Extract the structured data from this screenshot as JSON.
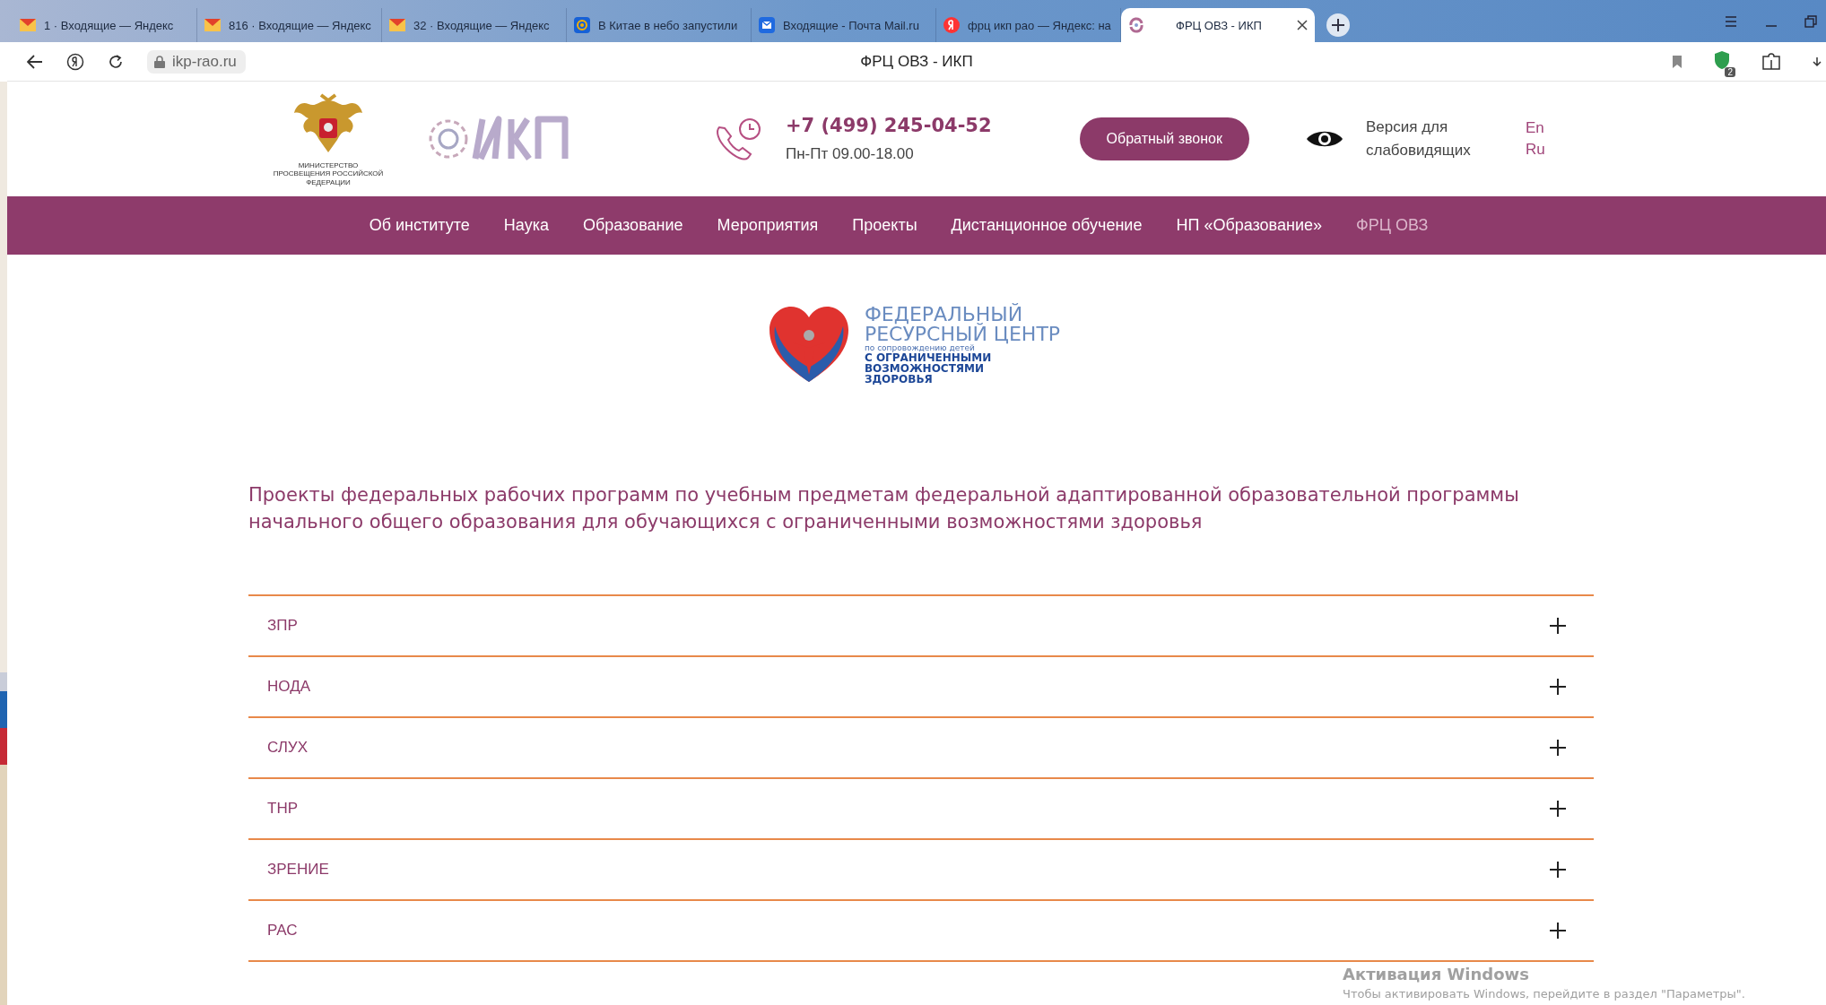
{
  "browser": {
    "tabs": [
      {
        "title": "1 · Входящие — Яндекс",
        "kind": "mail",
        "selected": false
      },
      {
        "title": "816 · Входящие — Яндекс",
        "kind": "mail",
        "selected": false
      },
      {
        "title": "32 · Входящие — Яндекс",
        "kind": "mail",
        "selected": false
      },
      {
        "title": "В Китае в небо запустили",
        "kind": "at",
        "selected": false
      },
      {
        "title": "Входящие - Почта Mail.ru",
        "kind": "envelope",
        "selected": false
      },
      {
        "title": "фрц икп рао — Яндекс: на",
        "kind": "yandex",
        "selected": false
      },
      {
        "title": "ФРЦ ОВЗ - ИКП",
        "kind": "site",
        "selected": true
      }
    ],
    "address": "ikp-rao.ru",
    "page_title": "ФРЦ ОВЗ - ИКП",
    "extension_badge": "2"
  },
  "header": {
    "ministry_caption": "МИНИСТЕРСТВО ПРОСВЕЩЕНИЯ РОССИЙСКОЙ ФЕДЕРАЦИИ",
    "phone": "+7 (499) 245-04-52",
    "hours": "Пн-Пт 09.00-18.00",
    "callback_button": "Обратный звонок",
    "accessibility": "Версия для слабовидящих",
    "languages": [
      {
        "label": "En",
        "selected": false
      },
      {
        "label": "Ru",
        "selected": false
      }
    ]
  },
  "nav": [
    {
      "label": "Об институте",
      "selected": false
    },
    {
      "label": "Наука",
      "selected": false
    },
    {
      "label": "Образование",
      "selected": false
    },
    {
      "label": "Мероприятия",
      "selected": false
    },
    {
      "label": "Проекты",
      "selected": false
    },
    {
      "label": "Дистанционное обучение",
      "selected": false
    },
    {
      "label": "НП «Образование»",
      "selected": false
    },
    {
      "label": "ФРЦ ОВЗ",
      "selected": true
    }
  ],
  "center_logo": {
    "line1": "ФЕДЕРАЛЬНЫЙ",
    "line2": "РЕСУРСНЫЙ ЦЕНТР",
    "line3": "по сопровождению детей",
    "line4": "С ОГРАНИЧЕННЫМИ",
    "line5": "ВОЗМОЖНОСТЯМИ",
    "line6": "ЗДОРОВЬЯ"
  },
  "heading": "Проекты федеральных рабочих программ по учебным предметам федеральной адаптированной образовательной программы начального общего образования для обучающихся с ограниченными возможностями здоровья",
  "accordion": [
    {
      "label": "ЗПР",
      "expanded": false
    },
    {
      "label": "НОДА",
      "expanded": false
    },
    {
      "label": "СЛУХ",
      "expanded": false
    },
    {
      "label": "ТНР",
      "expanded": false
    },
    {
      "label": "ЗРЕНИЕ",
      "expanded": false
    },
    {
      "label": "РАС",
      "expanded": false
    }
  ],
  "os_notice": {
    "title": "Активация Windows",
    "text": "Чтобы активировать Windows, перейдите в раздел \"Параметры\"."
  }
}
